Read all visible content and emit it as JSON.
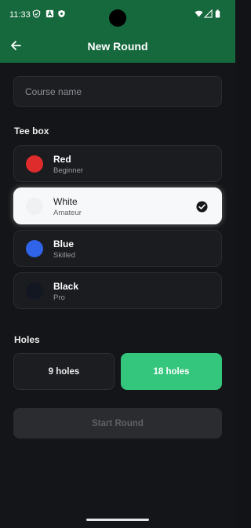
{
  "status_bar": {
    "time": "11:33",
    "left_icons": [
      "shield-check-icon",
      "a-box-icon",
      "shield-icon"
    ],
    "right_icons": [
      "wifi-icon",
      "cell-signal-icon",
      "battery-icon"
    ]
  },
  "app_bar": {
    "back_icon": "arrow-left-icon",
    "title": "New Round",
    "color": "#16693d"
  },
  "course": {
    "value": "",
    "placeholder": "Course name"
  },
  "tee_box": {
    "label": "Tee box",
    "options": [
      {
        "name": "Red",
        "level": "Beginner",
        "color": "#de2b2b",
        "selected": false
      },
      {
        "name": "White",
        "level": "Amateur",
        "color": "#eff1f3",
        "selected": true
      },
      {
        "name": "Blue",
        "level": "Skilled",
        "color": "#2f63e8",
        "selected": false
      },
      {
        "name": "Black",
        "level": "Pro",
        "color": "#121722",
        "selected": false
      }
    ]
  },
  "holes": {
    "label": "Holes",
    "options": [
      {
        "label": "9 holes",
        "selected": false
      },
      {
        "label": "18 holes",
        "selected": true
      }
    ],
    "accent": "#34c67d"
  },
  "start_button": {
    "label": "Start Round",
    "enabled": false
  }
}
